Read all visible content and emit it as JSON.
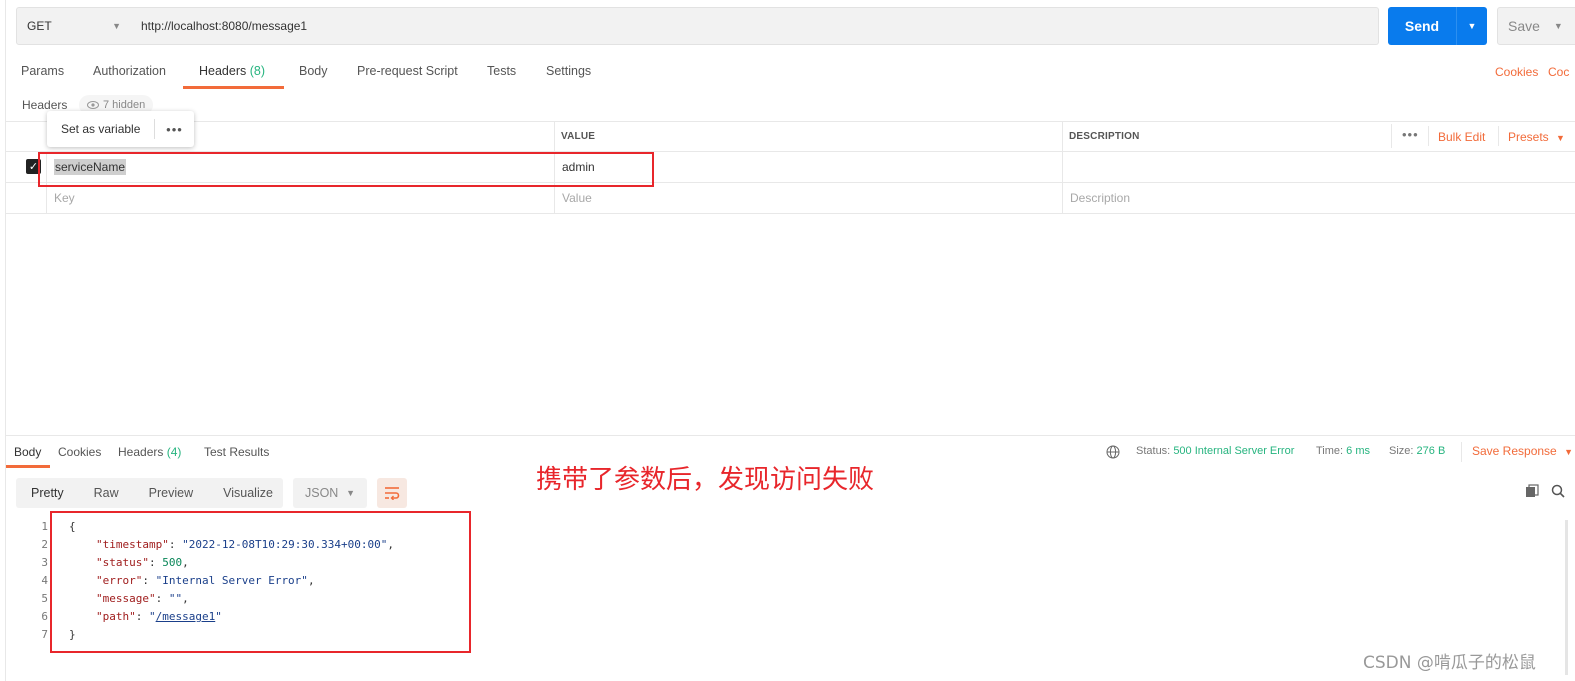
{
  "request": {
    "method": "GET",
    "url": "http://localhost:8080/message1",
    "send_label": "Send",
    "save_label": "Save"
  },
  "request_tabs": {
    "params": "Params",
    "authorization": "Authorization",
    "headers": "Headers",
    "headers_count": "(8)",
    "body": "Body",
    "prerequest": "Pre-request Script",
    "tests": "Tests",
    "settings": "Settings",
    "cookies": "Cookies",
    "code": "Coc"
  },
  "headers_section": {
    "title": "Headers",
    "hidden": "7 hidden",
    "popup_label": "Set as variable",
    "columns": {
      "value": "VALUE",
      "description": "DESCRIPTION"
    },
    "bulk_edit": "Bulk Edit",
    "presets": "Presets",
    "rows": [
      {
        "key": "serviceName",
        "value": "admin",
        "description": ""
      }
    ],
    "placeholders": {
      "key": "Key",
      "value": "Value",
      "description": "Description"
    }
  },
  "response": {
    "tabs": {
      "body": "Body",
      "cookies": "Cookies",
      "headers": "Headers",
      "headers_count": "(4)",
      "tests": "Test Results"
    },
    "status_label": "Status:",
    "status_value": "500 Internal Server Error",
    "time_label": "Time:",
    "time_value": "6 ms",
    "size_label": "Size:",
    "size_value": "276 B",
    "save_response": "Save Response",
    "formats": {
      "pretty": "Pretty",
      "raw": "Raw",
      "preview": "Preview",
      "visualize": "Visualize"
    },
    "language": "JSON",
    "body_lines": [
      {
        "n": "1",
        "text": "{"
      },
      {
        "n": "2",
        "k": "\"timestamp\"",
        "v": "\"2022-12-08T10:29:30.334+00:00\""
      },
      {
        "n": "3",
        "k": "\"status\"",
        "v": "500"
      },
      {
        "n": "4",
        "k": "\"error\"",
        "v": "\"Internal Server Error\""
      },
      {
        "n": "5",
        "k": "\"message\"",
        "v": "\"\""
      },
      {
        "n": "6",
        "k": "\"path\"",
        "v": "/message1"
      },
      {
        "n": "7",
        "text": "}"
      }
    ]
  },
  "annotation": "携带了参数后，发现访问失败",
  "watermark": "CSDN @啃瓜子的松鼠",
  "colors": {
    "accent": "#f26b3a",
    "send": "#097bed",
    "success": "#26b47f",
    "annotation": "#e8262b"
  }
}
